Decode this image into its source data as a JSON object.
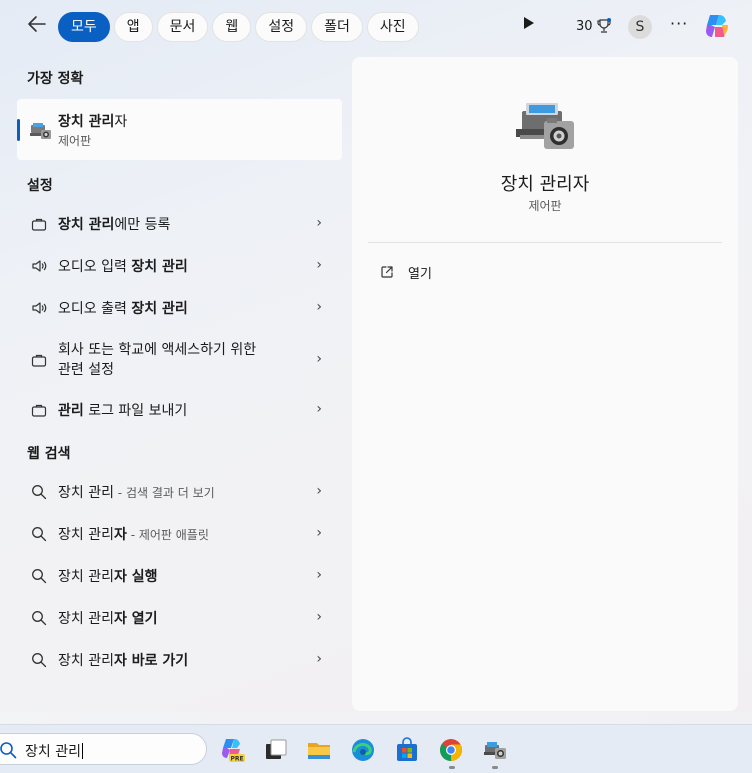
{
  "topbar": {
    "back_icon": "arrow-left-icon",
    "filters": [
      "모두",
      "앱",
      "문서",
      "웹",
      "설정",
      "폴더",
      "사진"
    ],
    "active_filter_index": 0,
    "points": "30",
    "avatar_letter": "S",
    "more_label": "···"
  },
  "best_match": {
    "section_title": "가장 정확",
    "name_bold": "장치 관리",
    "name_rest": "자",
    "sub": "제어판"
  },
  "settings": {
    "section_title": "설정",
    "items": [
      {
        "icon": "briefcase-icon",
        "parts": [
          {
            "t": "장치 관리",
            "b": true
          },
          {
            "t": "에만 등록",
            "b": false
          }
        ]
      },
      {
        "icon": "speaker-icon",
        "parts": [
          {
            "t": "오디오 입력 ",
            "b": false
          },
          {
            "t": "장치 관리",
            "b": true
          }
        ]
      },
      {
        "icon": "speaker-icon",
        "parts": [
          {
            "t": "오디오 출력 ",
            "b": false
          },
          {
            "t": "장치 관리",
            "b": true
          }
        ]
      },
      {
        "icon": "briefcase-icon",
        "line1": "회사 또는 학교에 액세스하기 위한",
        "line2": "관련 설정"
      },
      {
        "icon": "briefcase-icon",
        "parts": [
          {
            "t": "관리",
            "b": true
          },
          {
            "t": " 로그 파일 보내기",
            "b": false
          }
        ]
      }
    ]
  },
  "web": {
    "section_title": "웹 검색",
    "items": [
      {
        "main": "장치 관리",
        "main_bold": false,
        "hint": " - 검색 결과 더 보기"
      },
      {
        "main": "장치 관리",
        "bold": "자",
        "hint": " - 제어판 애플릿"
      },
      {
        "main": "장치 관리",
        "bold": "자 실행"
      },
      {
        "main": "장치 관리",
        "bold": "자 열기"
      },
      {
        "main": "장치 관리",
        "bold": "자 바로 가기"
      }
    ]
  },
  "detail": {
    "title": "장치 관리자",
    "subtitle": "제어판",
    "open_label": "열기"
  },
  "taskbar": {
    "search_value": "장치 관리",
    "pre_badge": "PRE"
  },
  "colors": {
    "accent": "#0a5fc2"
  }
}
